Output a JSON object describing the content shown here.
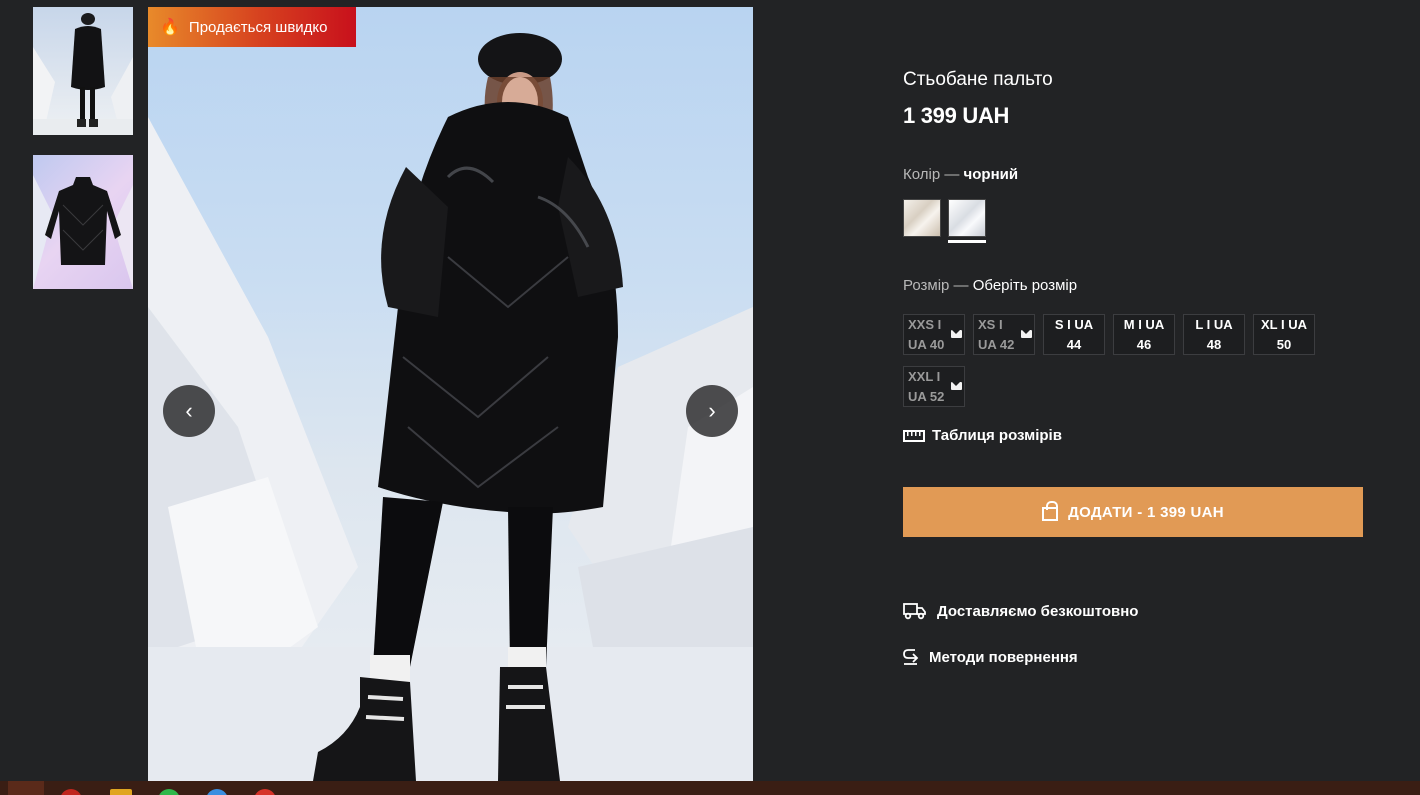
{
  "badge": {
    "label": "Продається швидко",
    "icon": "fire-icon"
  },
  "gallery": {
    "prev_icon": "chevron-left-icon",
    "next_icon": "chevron-right-icon"
  },
  "product": {
    "title": "Стьобане пальто",
    "price": "1 399 UAH",
    "color": {
      "label": "Колір —",
      "value": "чорний"
    },
    "size": {
      "label": "Розмір —",
      "value": "Оберіть розмір"
    },
    "sizes": [
      {
        "line1": "XXS I",
        "line2": "UA 40",
        "available": false
      },
      {
        "line1": "XS I",
        "line2": "UA 42",
        "available": false
      },
      {
        "line1": "S I UA",
        "line2": "44",
        "available": true
      },
      {
        "line1": "M I UA",
        "line2": "46",
        "available": true
      },
      {
        "line1": "L I UA",
        "line2": "48",
        "available": true
      },
      {
        "line1": "XL I UA",
        "line2": "50",
        "available": true
      },
      {
        "line1": "XXL I",
        "line2": "UA 52",
        "available": false
      }
    ],
    "size_table_label": "Таблиця розмірів",
    "add_button_label": "ДОДАТИ - 1 399 UAH",
    "delivery_label": "Доставляємо безкоштовно",
    "returns_label": "Методи повернення"
  },
  "colors": {
    "accent": "#e19a55",
    "background": "#222325",
    "badge_start": "#e88a2a",
    "badge_end": "#c8101c"
  }
}
